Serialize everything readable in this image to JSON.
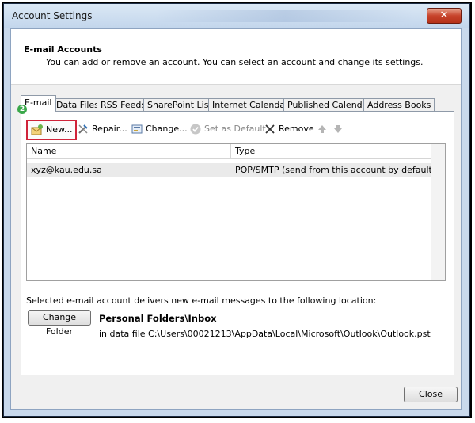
{
  "window": {
    "title": "Account Settings"
  },
  "header": {
    "title": "E-mail Accounts",
    "subtitle": "You can add or remove an account. You can select an account and change its settings."
  },
  "tabs": [
    {
      "label": "E-mail"
    },
    {
      "label": "Data Files"
    },
    {
      "label": "RSS Feeds"
    },
    {
      "label": "SharePoint Lists"
    },
    {
      "label": "Internet Calendars"
    },
    {
      "label": "Published Calendars"
    },
    {
      "label": "Address Books"
    }
  ],
  "step_badge": "2",
  "toolbar": {
    "new": "New...",
    "repair": "Repair...",
    "change": "Change...",
    "set_default": "Set as Default",
    "remove": "Remove",
    "move_up_icon": "arrow-up-icon",
    "move_down_icon": "arrow-down-icon"
  },
  "list": {
    "columns": [
      "Name",
      "Type"
    ],
    "rows": [
      {
        "name": "xyz@kau.edu.sa",
        "type": "POP/SMTP (send from this account by default)"
      }
    ]
  },
  "delivery": {
    "text": "Selected e-mail account delivers new e-mail messages to the following location:",
    "change_folder": "Change Folder",
    "folder": "Personal Folders\\Inbox",
    "data_file": "in data file C:\\Users\\00021213\\AppData\\Local\\Microsoft\\Outlook\\Outlook.pst"
  },
  "footer": {
    "close": "Close"
  },
  "colors": {
    "highlight": "#d0243a",
    "badge": "#3aa84a",
    "window_frame": "#c9d9ec"
  }
}
